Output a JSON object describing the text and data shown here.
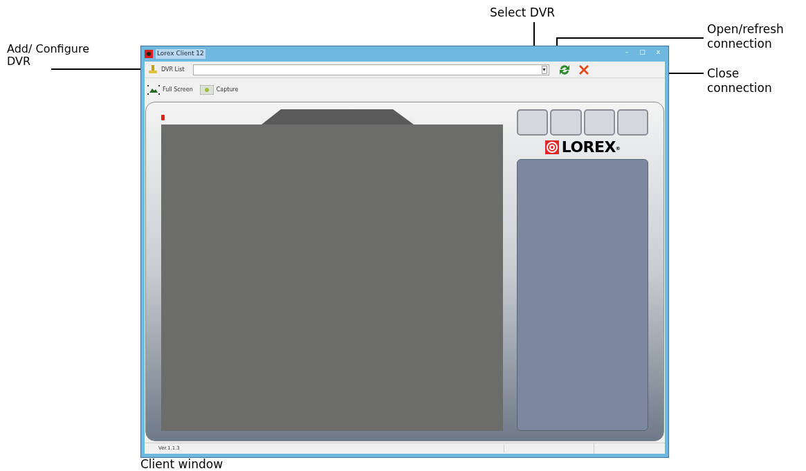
{
  "window": {
    "title": "Lorex Client 12",
    "controls": [
      "–",
      "□",
      "x"
    ]
  },
  "toolbar": {
    "dvr_list_label": "DVR List",
    "dropdown_arrow": "▾"
  },
  "toolbar_2": {
    "buttons": [
      {
        "kind": "fullscreen",
        "label": "Full Screen"
      },
      {
        "kind": "capture",
        "label": "Capture"
      }
    ]
  },
  "right_panel": {
    "logo": "LOREX",
    "logo_mark": "®"
  },
  "status_bar": {
    "version": "Ver.1.1.3"
  },
  "callouts": {
    "add_configure": "Add/ Configure DVR",
    "select": "Select DVR",
    "open_refresh": "Open/refresh connection",
    "close": "Close connection",
    "caption": "Client window"
  }
}
